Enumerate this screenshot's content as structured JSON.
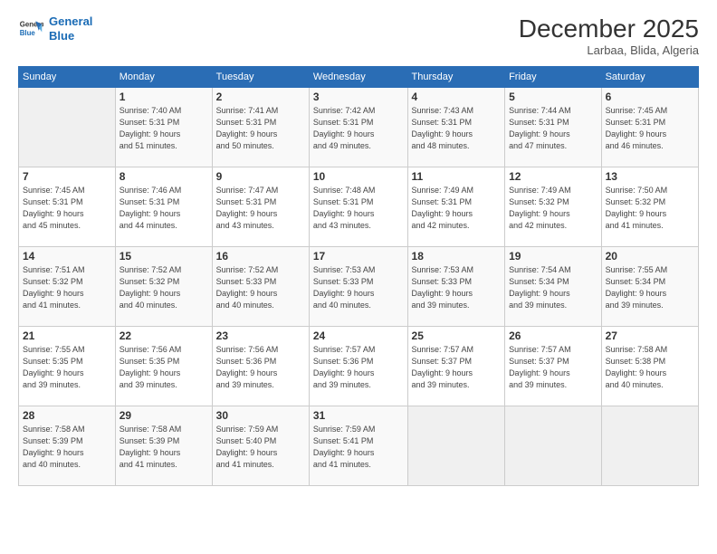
{
  "header": {
    "logo": {
      "line1": "General",
      "line2": "Blue"
    },
    "title": "December 2025",
    "location": "Larbaa, Blida, Algeria"
  },
  "days_of_week": [
    "Sunday",
    "Monday",
    "Tuesday",
    "Wednesday",
    "Thursday",
    "Friday",
    "Saturday"
  ],
  "weeks": [
    [
      {
        "day": "",
        "info": ""
      },
      {
        "day": "1",
        "info": "Sunrise: 7:40 AM\nSunset: 5:31 PM\nDaylight: 9 hours\nand 51 minutes."
      },
      {
        "day": "2",
        "info": "Sunrise: 7:41 AM\nSunset: 5:31 PM\nDaylight: 9 hours\nand 50 minutes."
      },
      {
        "day": "3",
        "info": "Sunrise: 7:42 AM\nSunset: 5:31 PM\nDaylight: 9 hours\nand 49 minutes."
      },
      {
        "day": "4",
        "info": "Sunrise: 7:43 AM\nSunset: 5:31 PM\nDaylight: 9 hours\nand 48 minutes."
      },
      {
        "day": "5",
        "info": "Sunrise: 7:44 AM\nSunset: 5:31 PM\nDaylight: 9 hours\nand 47 minutes."
      },
      {
        "day": "6",
        "info": "Sunrise: 7:45 AM\nSunset: 5:31 PM\nDaylight: 9 hours\nand 46 minutes."
      }
    ],
    [
      {
        "day": "7",
        "info": "Sunrise: 7:45 AM\nSunset: 5:31 PM\nDaylight: 9 hours\nand 45 minutes."
      },
      {
        "day": "8",
        "info": "Sunrise: 7:46 AM\nSunset: 5:31 PM\nDaylight: 9 hours\nand 44 minutes."
      },
      {
        "day": "9",
        "info": "Sunrise: 7:47 AM\nSunset: 5:31 PM\nDaylight: 9 hours\nand 43 minutes."
      },
      {
        "day": "10",
        "info": "Sunrise: 7:48 AM\nSunset: 5:31 PM\nDaylight: 9 hours\nand 43 minutes."
      },
      {
        "day": "11",
        "info": "Sunrise: 7:49 AM\nSunset: 5:31 PM\nDaylight: 9 hours\nand 42 minutes."
      },
      {
        "day": "12",
        "info": "Sunrise: 7:49 AM\nSunset: 5:32 PM\nDaylight: 9 hours\nand 42 minutes."
      },
      {
        "day": "13",
        "info": "Sunrise: 7:50 AM\nSunset: 5:32 PM\nDaylight: 9 hours\nand 41 minutes."
      }
    ],
    [
      {
        "day": "14",
        "info": "Sunrise: 7:51 AM\nSunset: 5:32 PM\nDaylight: 9 hours\nand 41 minutes."
      },
      {
        "day": "15",
        "info": "Sunrise: 7:52 AM\nSunset: 5:32 PM\nDaylight: 9 hours\nand 40 minutes."
      },
      {
        "day": "16",
        "info": "Sunrise: 7:52 AM\nSunset: 5:33 PM\nDaylight: 9 hours\nand 40 minutes."
      },
      {
        "day": "17",
        "info": "Sunrise: 7:53 AM\nSunset: 5:33 PM\nDaylight: 9 hours\nand 40 minutes."
      },
      {
        "day": "18",
        "info": "Sunrise: 7:53 AM\nSunset: 5:33 PM\nDaylight: 9 hours\nand 39 minutes."
      },
      {
        "day": "19",
        "info": "Sunrise: 7:54 AM\nSunset: 5:34 PM\nDaylight: 9 hours\nand 39 minutes."
      },
      {
        "day": "20",
        "info": "Sunrise: 7:55 AM\nSunset: 5:34 PM\nDaylight: 9 hours\nand 39 minutes."
      }
    ],
    [
      {
        "day": "21",
        "info": "Sunrise: 7:55 AM\nSunset: 5:35 PM\nDaylight: 9 hours\nand 39 minutes."
      },
      {
        "day": "22",
        "info": "Sunrise: 7:56 AM\nSunset: 5:35 PM\nDaylight: 9 hours\nand 39 minutes."
      },
      {
        "day": "23",
        "info": "Sunrise: 7:56 AM\nSunset: 5:36 PM\nDaylight: 9 hours\nand 39 minutes."
      },
      {
        "day": "24",
        "info": "Sunrise: 7:57 AM\nSunset: 5:36 PM\nDaylight: 9 hours\nand 39 minutes."
      },
      {
        "day": "25",
        "info": "Sunrise: 7:57 AM\nSunset: 5:37 PM\nDaylight: 9 hours\nand 39 minutes."
      },
      {
        "day": "26",
        "info": "Sunrise: 7:57 AM\nSunset: 5:37 PM\nDaylight: 9 hours\nand 39 minutes."
      },
      {
        "day": "27",
        "info": "Sunrise: 7:58 AM\nSunset: 5:38 PM\nDaylight: 9 hours\nand 40 minutes."
      }
    ],
    [
      {
        "day": "28",
        "info": "Sunrise: 7:58 AM\nSunset: 5:39 PM\nDaylight: 9 hours\nand 40 minutes."
      },
      {
        "day": "29",
        "info": "Sunrise: 7:58 AM\nSunset: 5:39 PM\nDaylight: 9 hours\nand 41 minutes."
      },
      {
        "day": "30",
        "info": "Sunrise: 7:59 AM\nSunset: 5:40 PM\nDaylight: 9 hours\nand 41 minutes."
      },
      {
        "day": "31",
        "info": "Sunrise: 7:59 AM\nSunset: 5:41 PM\nDaylight: 9 hours\nand 41 minutes."
      },
      {
        "day": "",
        "info": ""
      },
      {
        "day": "",
        "info": ""
      },
      {
        "day": "",
        "info": ""
      }
    ]
  ]
}
